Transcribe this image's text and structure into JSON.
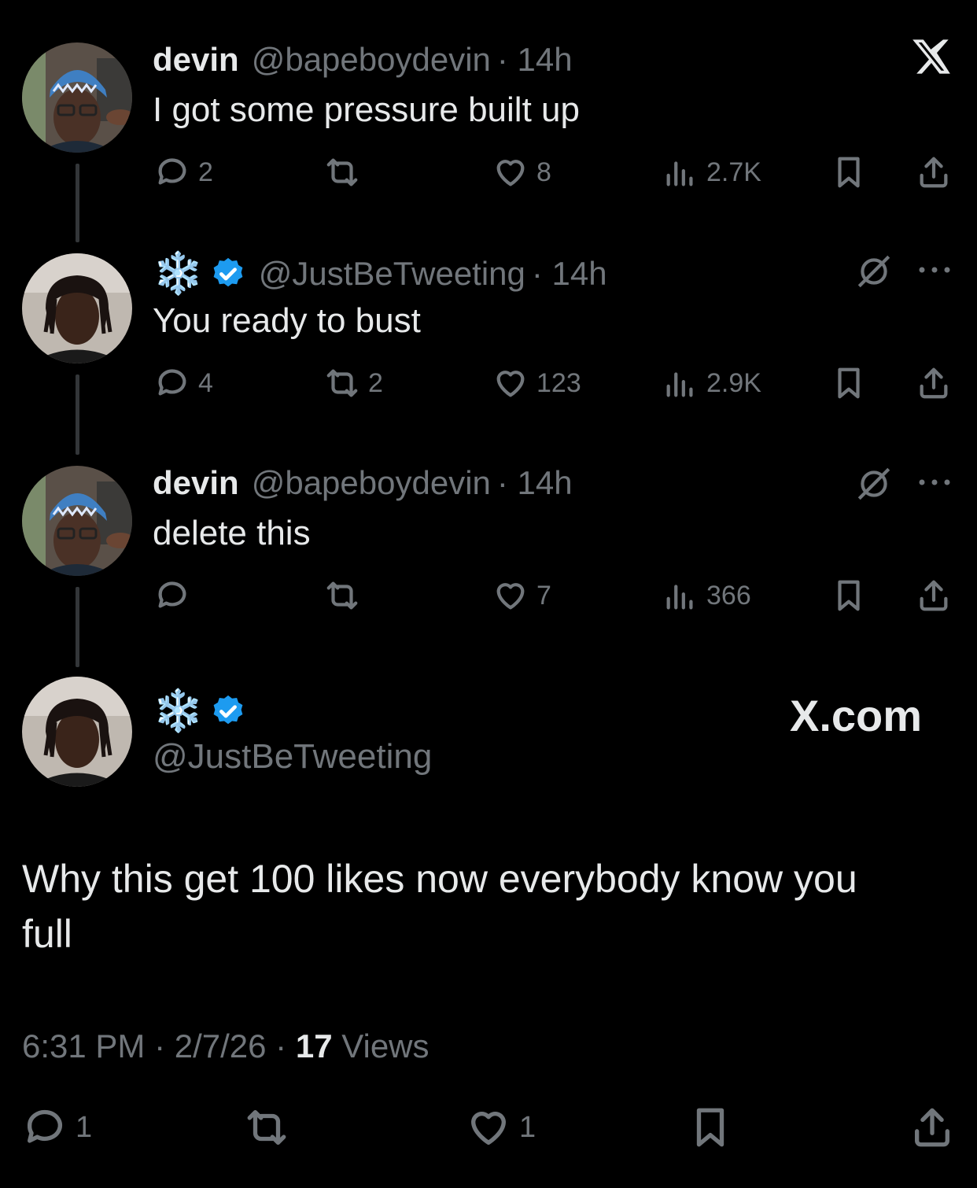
{
  "app_logo": "X",
  "tweets": [
    {
      "name": "devin",
      "handle": "@bapeboydevin",
      "time": "· 14h",
      "text": "I got some pressure built up",
      "replies": "2",
      "reposts": "",
      "likes": "8",
      "views": "2.7K"
    },
    {
      "name": "❄️",
      "handle": "@JustBeTweeting",
      "time": "· 14h",
      "text": "You ready to bust",
      "replies": "4",
      "reposts": "2",
      "likes": "123",
      "views": "2.9K"
    },
    {
      "name": "devin",
      "handle": "@bapeboydevin",
      "time": "· 14h",
      "text": "delete this",
      "replies": "",
      "reposts": "",
      "likes": "7",
      "views": "366"
    }
  ],
  "main_tweet": {
    "name": "❄️",
    "handle": "@JustBeTweeting",
    "watermark": "X.com",
    "text_line1": "Why this get 100 likes now everybody know you",
    "text_line2": "full",
    "timestamp": "6:31 PM · 2/7/26 · ",
    "views_count": "17",
    "views_label": " Views",
    "replies": "1",
    "reposts": "",
    "likes": "1"
  },
  "colors": {
    "background": "#000000",
    "text": "#e7e9ea",
    "muted": "#71767b",
    "verified": "#1d9bf0"
  }
}
